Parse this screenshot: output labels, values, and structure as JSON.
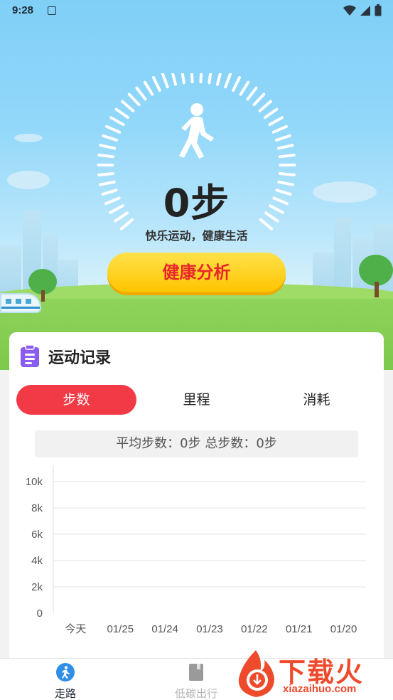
{
  "status_bar": {
    "time": "9:28"
  },
  "hero": {
    "steps_text": "0步",
    "slogan": "快乐运动，健康生活",
    "analysis_button": "健康分析"
  },
  "record_card": {
    "title": "运动记录",
    "tabs": [
      {
        "label": "步数",
        "active": true
      },
      {
        "label": "里程",
        "active": false
      },
      {
        "label": "消耗",
        "active": false
      }
    ],
    "summary": "平均步数：0步 总步数：0步"
  },
  "chart_data": {
    "type": "bar",
    "categories": [
      "今天",
      "01/25",
      "01/24",
      "01/23",
      "01/22",
      "01/21",
      "01/20"
    ],
    "series": [
      {
        "values": [
          0,
          0,
          0,
          0,
          0,
          0,
          0
        ]
      }
    ],
    "y_ticks": [
      "0",
      "2k",
      "4k",
      "6k",
      "8k",
      "10k"
    ],
    "ylim": [
      0,
      10000
    ],
    "grid": true
  },
  "bottom_nav": {
    "items": [
      {
        "label": "走路",
        "active": true
      },
      {
        "label": "低碳出行",
        "active": false
      }
    ]
  },
  "watermark": {
    "brand": "下载火",
    "url": "xiazaihuo.com"
  },
  "colors": {
    "accent_red": "#f23a47",
    "button_yellow": "#ffd21e",
    "button_text": "#e8262c",
    "sky": "#8fd4f8"
  }
}
